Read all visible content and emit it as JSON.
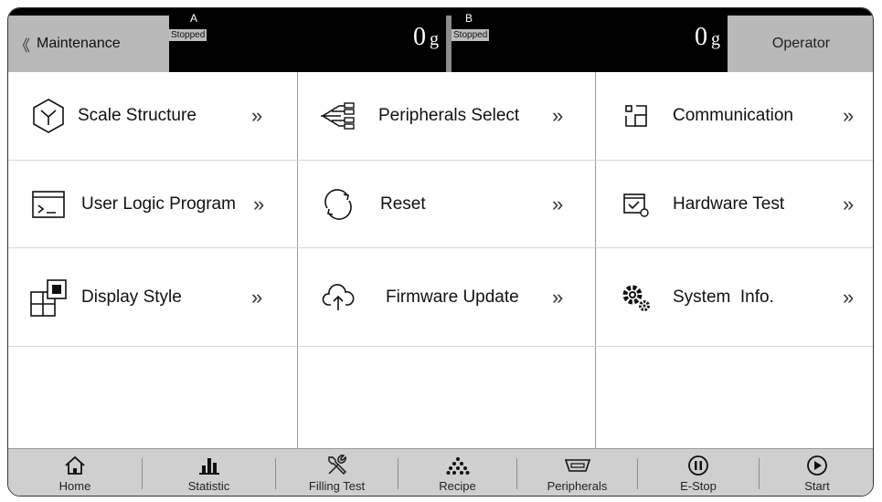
{
  "header": {
    "back_icon": "double-chevron-left",
    "title": "Maintenance",
    "scale_a": {
      "letter": "A",
      "status": "Stopped",
      "weight": "0",
      "unit": "g"
    },
    "scale_b": {
      "letter": "B",
      "status": "Stopped",
      "weight": "0",
      "unit": "g"
    },
    "operator_label": "Operator"
  },
  "menu": {
    "scale_structure": {
      "label": "Scale Structure",
      "icon": "hexagon-structure-icon"
    },
    "peripherals_select": {
      "label": "Peripherals Select",
      "icon": "branch-tree-icon"
    },
    "communication": {
      "label": "Communication",
      "icon": "communication-icon"
    },
    "user_logic_program": {
      "label": "User Logic Program",
      "icon": "terminal-window-icon"
    },
    "reset": {
      "label": "Reset",
      "icon": "refresh-icon"
    },
    "hardware_test": {
      "label": "Hardware Test",
      "icon": "hardware-check-icon"
    },
    "display_style": {
      "label": "Display Style",
      "icon": "layout-grid-icon"
    },
    "firmware_update": {
      "label": "Firmware Update",
      "icon": "cloud-upload-icon"
    },
    "system_info": {
      "label": "System  Info.",
      "icon": "gears-icon"
    },
    "arrow": "»"
  },
  "footer": {
    "home": "Home",
    "statistic": "Statistic",
    "filling_test": "Filling Test",
    "recipe": "Recipe",
    "peripherals": "Peripherals",
    "estop": "E-Stop",
    "start": "Start"
  },
  "colors": {
    "header_bg": "#000000",
    "panel_gray": "#b9b9b9",
    "footer_bg": "#cfcfcf"
  }
}
